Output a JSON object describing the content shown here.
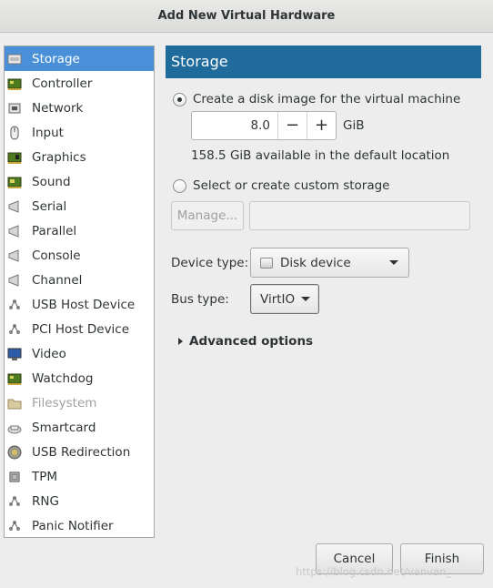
{
  "window": {
    "title": "Add New Virtual Hardware"
  },
  "sidebar": {
    "items": [
      {
        "label": "Storage",
        "icon": "storage-icon",
        "selected": true
      },
      {
        "label": "Controller",
        "icon": "controller-icon"
      },
      {
        "label": "Network",
        "icon": "network-icon"
      },
      {
        "label": "Input",
        "icon": "mouse-icon"
      },
      {
        "label": "Graphics",
        "icon": "graphics-icon"
      },
      {
        "label": "Sound",
        "icon": "sound-icon"
      },
      {
        "label": "Serial",
        "icon": "serial-icon"
      },
      {
        "label": "Parallel",
        "icon": "parallel-icon"
      },
      {
        "label": "Console",
        "icon": "console-icon"
      },
      {
        "label": "Channel",
        "icon": "channel-icon"
      },
      {
        "label": "USB Host Device",
        "icon": "usb-host-icon"
      },
      {
        "label": "PCI Host Device",
        "icon": "pci-host-icon"
      },
      {
        "label": "Video",
        "icon": "video-icon"
      },
      {
        "label": "Watchdog",
        "icon": "watchdog-icon"
      },
      {
        "label": "Filesystem",
        "icon": "folder-icon",
        "disabled": true
      },
      {
        "label": "Smartcard",
        "icon": "smartcard-icon"
      },
      {
        "label": "USB Redirection",
        "icon": "usb-redirection-icon"
      },
      {
        "label": "TPM",
        "icon": "tpm-chip-icon"
      },
      {
        "label": "RNG",
        "icon": "rng-icon"
      },
      {
        "label": "Panic Notifier",
        "icon": "panic-notifier-icon"
      }
    ]
  },
  "main": {
    "header": "Storage",
    "create_disk": {
      "label": "Create a disk image for the virtual machine",
      "checked": true,
      "size_value": "8.0",
      "decrement": "−",
      "increment": "+",
      "unit": "GiB",
      "available_text": "158.5 GiB available in the default location"
    },
    "custom_storage": {
      "label": "Select or create custom storage",
      "checked": false,
      "manage_button": "Manage...",
      "path_value": ""
    },
    "device_type": {
      "label": "Device type:",
      "value": "Disk device",
      "icon": "disk-device-icon"
    },
    "bus_type": {
      "label": "Bus type:",
      "value": "VirtIO"
    },
    "advanced": {
      "label": "Advanced options"
    }
  },
  "footer": {
    "cancel": "Cancel",
    "finish": "Finish"
  },
  "watermark": "https://blog.csdn.net/vanvan_"
}
